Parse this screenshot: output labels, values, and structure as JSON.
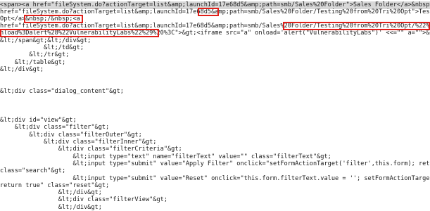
{
  "source_lines": [
    "<span><a href=\"fileSystem.do?actionTarget=list&amp;launchId=17e68d5&amp;path=smb/Sales%20Folder\">Sales Folder</a>&nbsp;/&nbsp;<a",
    "href=\"fileSystem.do?actionTarget=list&amp;launchId=17e68d5&amp;path=smb/Sales%20Folder/Testing%20from%20Tri%20Opt\">Testing from Tri",
    "Opt</a>&nbsp;/&nbsp;<a",
    "href=\"fileSystem.do?actionTarget=list&amp;launchId=17e68d5&amp;path=smb/Sales%20Folder/Testing%20from%20Tri%20Opt/%22%3E%3Ciframe%20src%3",
    "nload%3Dalert%28%22VulnerabilityLabs%22%29%20%3C\">&gt;<iframe src=\"a\" onload='alert(\"VulnerabilityLabs\")' <<=\"\" a=\"\">&amp;nbsp;/&amp;nbsp",
    "&lt;/span&gt;&lt;/div&gt;",
    "            &lt;/td&gt;",
    "        &lt;/tr&gt;",
    "    &lt;/table&gt;",
    "&lt;/div&gt;",
    "",
    "",
    "&lt;div class=\"dialog_content\"&gt;",
    "",
    "",
    "",
    "&lt;div id=\"view\"&gt;",
    "    &lt;div class=\"filter\"&gt;",
    "        &lt;div class=\"filterOuter\"&gt;",
    "            &lt;div class=\"filterInner\"&gt;",
    "                &lt;div class=\"filterCriteria\"&gt;",
    "                    &lt;input type=\"text\" name=\"filterText\" value=\"\" class=\"filterText\"&gt;",
    "                    &lt;input type=\"submit\" value=\"Apply Filter\" onclick=\"setFormActionTarget('filter',this.form); return true\"",
    "class=\"search\"&gt;",
    "                    &lt;input type=\"submit\" value=\"Reset\" onclick=\"this.form.filterText.value = ''; setFormActionTarget('filter',this.form",
    "return true\" class=\"reset\"&gt;",
    "                &lt;/div&gt;",
    "                &lt;div class=\"filterView\"&gt;",
    "                &lt;/div&gt;"
  ]
}
